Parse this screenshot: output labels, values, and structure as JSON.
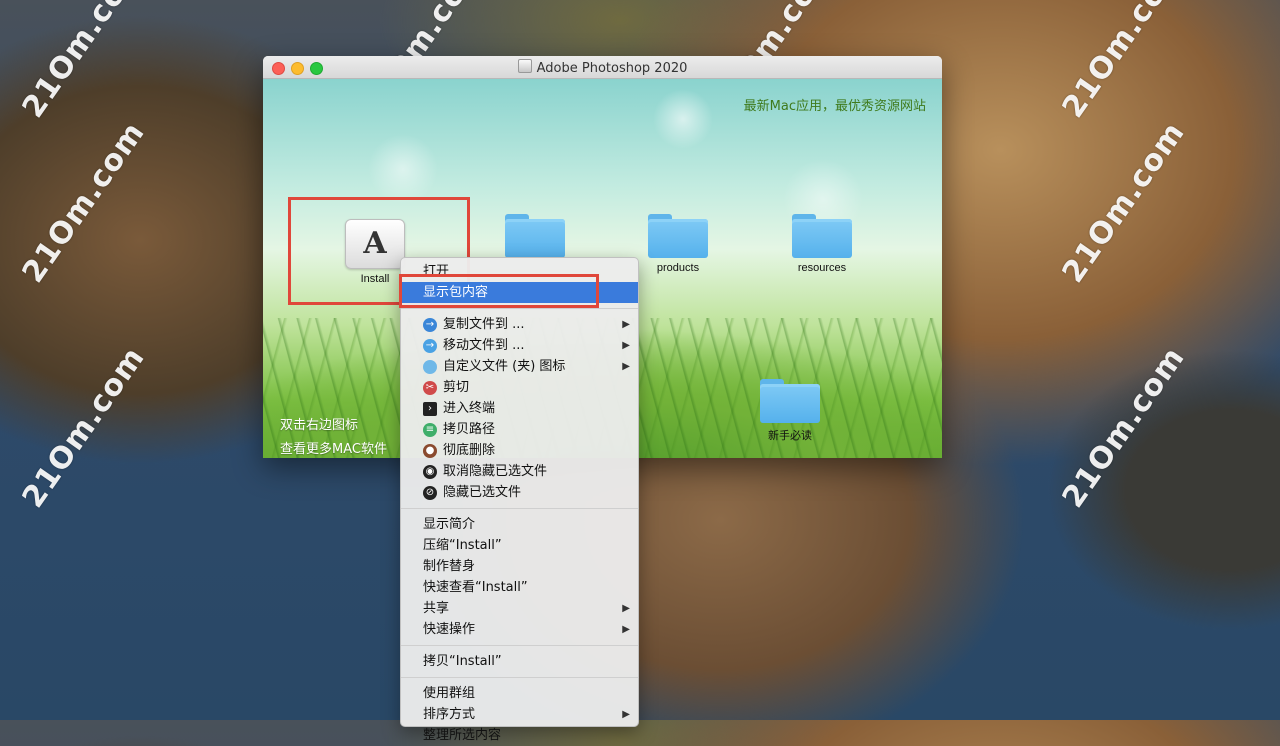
{
  "window": {
    "title": "Adobe Photoshop 2020",
    "slogan": "最新Mac应用，最优秀资源网站",
    "footer_line1": "双击右边图标",
    "footer_line2": "查看更多MAC软件"
  },
  "items": [
    {
      "label": "Install",
      "icon": "photoshop-installer-icon"
    },
    {
      "label": "",
      "icon": "folder-icon"
    },
    {
      "label": "products",
      "icon": "folder-icon"
    },
    {
      "label": "resources",
      "icon": "folder-icon"
    },
    {
      "label": "新手必读",
      "icon": "folder-icon"
    }
  ],
  "watermark": "21Om.com",
  "context_menu": {
    "open": "打开",
    "show_package_contents": "显示包内容",
    "copy_to": "复制文件到 ...",
    "move_to": "移动文件到 ...",
    "custom_icon": "自定义文件 (夹) 图标",
    "cut": "剪切",
    "open_terminal": "进入终端",
    "copy_path": "拷贝路径",
    "delete_permanently": "彻底删除",
    "unhide_selected": "取消隐藏已选文件",
    "hide_selected": "隐藏已选文件",
    "get_info": "显示简介",
    "compress": "压缩“Install”",
    "make_alias": "制作替身",
    "quick_look": "快速查看“Install”",
    "share": "共享",
    "quick_actions": "快速操作",
    "copy_item": "拷贝“Install”",
    "use_groups": "使用群组",
    "sort_by": "排序方式",
    "clean_up_selection": "整理所选内容"
  },
  "colors": {
    "highlight": "#e0473a",
    "menu_selected": "#3a7bdc"
  }
}
